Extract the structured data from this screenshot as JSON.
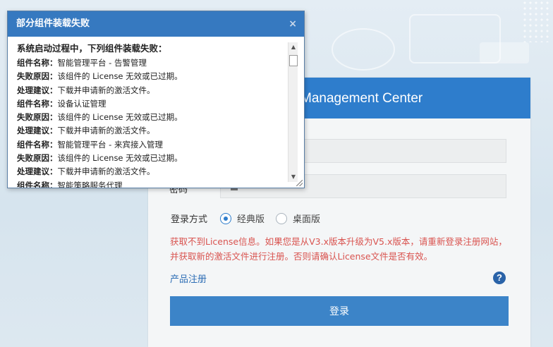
{
  "login": {
    "header_title": "Management Center",
    "password_label": "密码",
    "mode_label": "登录方式",
    "modes": [
      {
        "label": "经典版",
        "selected": true
      },
      {
        "label": "桌面版",
        "selected": false
      }
    ],
    "error_message": "获取不到License信息。如果您是从V3.x版本升级为V5.x版本，请重新登录注册网站，并获取新的激活文件进行注册。否则请确认License文件是否有效。",
    "register_link": "产品注册",
    "help_icon": "?",
    "login_button": "登录"
  },
  "dialog": {
    "title": "部分组件装载失败",
    "close_label": "×",
    "intro": "系统启动过程中，下列组件装载失败：",
    "rows": [
      {
        "key": "组件名称：",
        "value": "智能管理平台 - 告警管理"
      },
      {
        "key": "失败原因：",
        "value": "该组件的 License 无效或已过期。"
      },
      {
        "key": "处理建议：",
        "value": "下载并申请新的激活文件。"
      },
      {
        "key": "组件名称：",
        "value": "设备认证管理"
      },
      {
        "key": "失败原因：",
        "value": "该组件的 License 无效或已过期。"
      },
      {
        "key": "处理建议：",
        "value": "下载并申请新的激活文件。"
      },
      {
        "key": "组件名称：",
        "value": "智能管理平台 - 来宾接入管理"
      },
      {
        "key": "失败原因：",
        "value": "该组件的 License 无效或已过期。"
      },
      {
        "key": "处理建议：",
        "value": "下载并申请新的激活文件。"
      },
      {
        "key": "组件名称：",
        "value": "智能策略服务代理"
      }
    ]
  },
  "colors": {
    "accent": "#2e7dcc",
    "error": "#d9534f",
    "link": "#2e6eb5"
  }
}
